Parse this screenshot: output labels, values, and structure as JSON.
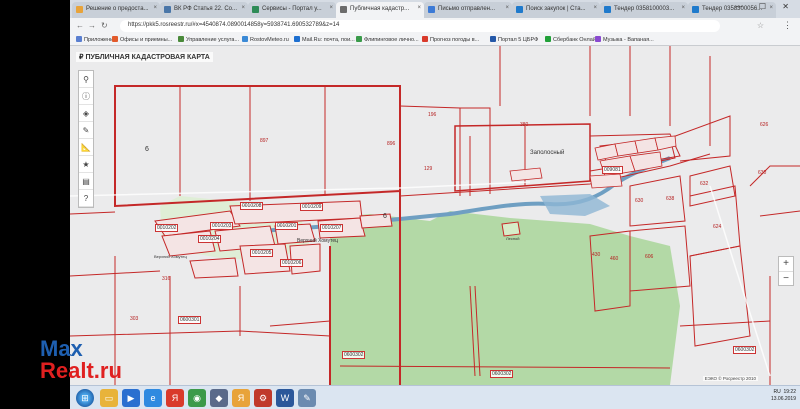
{
  "browser": {
    "tabs": [
      {
        "label": "Решение о предоста...",
        "color": "#e8a33a"
      },
      {
        "label": "ВК РФ Статья 22. Со...",
        "color": "#4a76a8"
      },
      {
        "label": "Сервисы - Портал у...",
        "color": "#2e8b57"
      },
      {
        "label": "Публичная кадастр...",
        "color": "#6c6c6c"
      },
      {
        "label": "Письмо отправлен...",
        "color": "#3c7ad6"
      },
      {
        "label": "Поиск закупок | Ста...",
        "color": "#1f7acc"
      },
      {
        "label": "Тендер 0358100003...",
        "color": "#1f7acc"
      },
      {
        "label": "Тендер 0358300056...",
        "color": "#1f7acc"
      }
    ],
    "url": "https://pkk5.rosreestr.ru/#x=4540874.0890014858y=5938741.690532789&z=14",
    "window_controls": "— ☐ ✕",
    "bookmarks": [
      {
        "label": "Приложения",
        "color": "#5a7fd0"
      },
      {
        "label": "Офисы и приемны...",
        "color": "#e25a2b"
      },
      {
        "label": "Управление услуга...",
        "color": "#4a8a3a"
      },
      {
        "label": "RostovMeteo.ru",
        "color": "#3b8ad6"
      },
      {
        "label": "Mail.Ru: почта, пои...",
        "color": "#1d6fd0"
      },
      {
        "label": "Флипинговое лично...",
        "color": "#3a9b4a"
      },
      {
        "label": "Прогноз погоды в...",
        "color": "#d93a2b"
      },
      {
        "label": "Портал 5 ЦБРФ",
        "color": "#2458a8"
      },
      {
        "label": "Сбербанк Онлайн",
        "color": "#21a038"
      },
      {
        "label": "Музыка - Вапаная...",
        "color": "#8a4ad0"
      }
    ]
  },
  "map": {
    "site_title": "ПУБЛИЧНАЯ КАДАСТРОВАЯ КАРТА",
    "logo": "₽",
    "tools": [
      {
        "icon": "search-icon",
        "glyph": "⚲"
      },
      {
        "icon": "info-icon",
        "glyph": "ⓘ"
      },
      {
        "icon": "layers-icon",
        "glyph": "◈"
      },
      {
        "icon": "pencil-icon",
        "glyph": "✎"
      },
      {
        "icon": "ruler-icon",
        "glyph": "📐"
      },
      {
        "icon": "star-icon",
        "glyph": "★"
      },
      {
        "icon": "print-icon",
        "glyph": "▤"
      },
      {
        "icon": "help-icon",
        "glyph": "?"
      }
    ],
    "zoom_in": "+",
    "zoom_out": "−",
    "copyright": "ЕЭКО © Росреестр 2010",
    "labels": {
      "n6_left": "6",
      "n6_mid": "6",
      "zapolosny": "Заполосный",
      "verkhny_komutets": "Верхний Хомутец",
      "verkhny_komutets2": "Верхний Хомутец",
      "lesnoy": "Лесной",
      "q0010208": "0010208",
      "q0010209": "0010209",
      "q0010202": "0010202",
      "q0010203": "0010203",
      "q0010204": "0010204",
      "q0010205": "0010205",
      "q0010206": "0010206",
      "q0010201": "0010201",
      "q0010207": "0010207",
      "q0600302a": "0600302",
      "q0600302b": "0600302",
      "q0600302c": "0600302",
      "q009081": "009081",
      "q0600301": "0600301",
      "p897": "897",
      "p896": "896",
      "p380": "380",
      "p196": "196",
      "p129": "129",
      "p632": "632",
      "p630": "630",
      "p638": "638",
      "p606": "606",
      "p624": "624",
      "p626": "626",
      "p630b": "630",
      "p460": "460",
      "p430": "430",
      "p316": "316",
      "p303": "303"
    }
  },
  "taskbar": {
    "apps": [
      {
        "name": "start-button",
        "glyph": "⊞",
        "color": "#1e5fa8"
      },
      {
        "name": "explorer-taskbar-icon",
        "glyph": "▭",
        "color": "#e8b33a"
      },
      {
        "name": "media-taskbar-icon",
        "glyph": "▶",
        "color": "#2a6fd0"
      },
      {
        "name": "ie-taskbar-icon",
        "glyph": "e",
        "color": "#2f8ae0"
      },
      {
        "name": "yandex-taskbar-icon",
        "glyph": "Я",
        "color": "#d93a2b"
      },
      {
        "name": "chrome-taskbar-icon",
        "glyph": "◉",
        "color": "#3c9a4a"
      },
      {
        "name": "app-taskbar-icon",
        "glyph": "◆",
        "color": "#5a6a8a"
      },
      {
        "name": "yandex2-taskbar-icon",
        "glyph": "Я",
        "color": "#e8a33a"
      },
      {
        "name": "tool-taskbar-icon",
        "glyph": "⚙",
        "color": "#c0392b"
      },
      {
        "name": "word-taskbar-icon",
        "glyph": "W",
        "color": "#2b579a"
      },
      {
        "name": "notepad-taskbar-icon",
        "glyph": "✎",
        "color": "#6b8bb0"
      }
    ],
    "tray_lang": "RU",
    "time": "19:22",
    "date": "13.06.2019"
  },
  "watermark": {
    "line1": "Max",
    "line2": "Realt.ru"
  }
}
